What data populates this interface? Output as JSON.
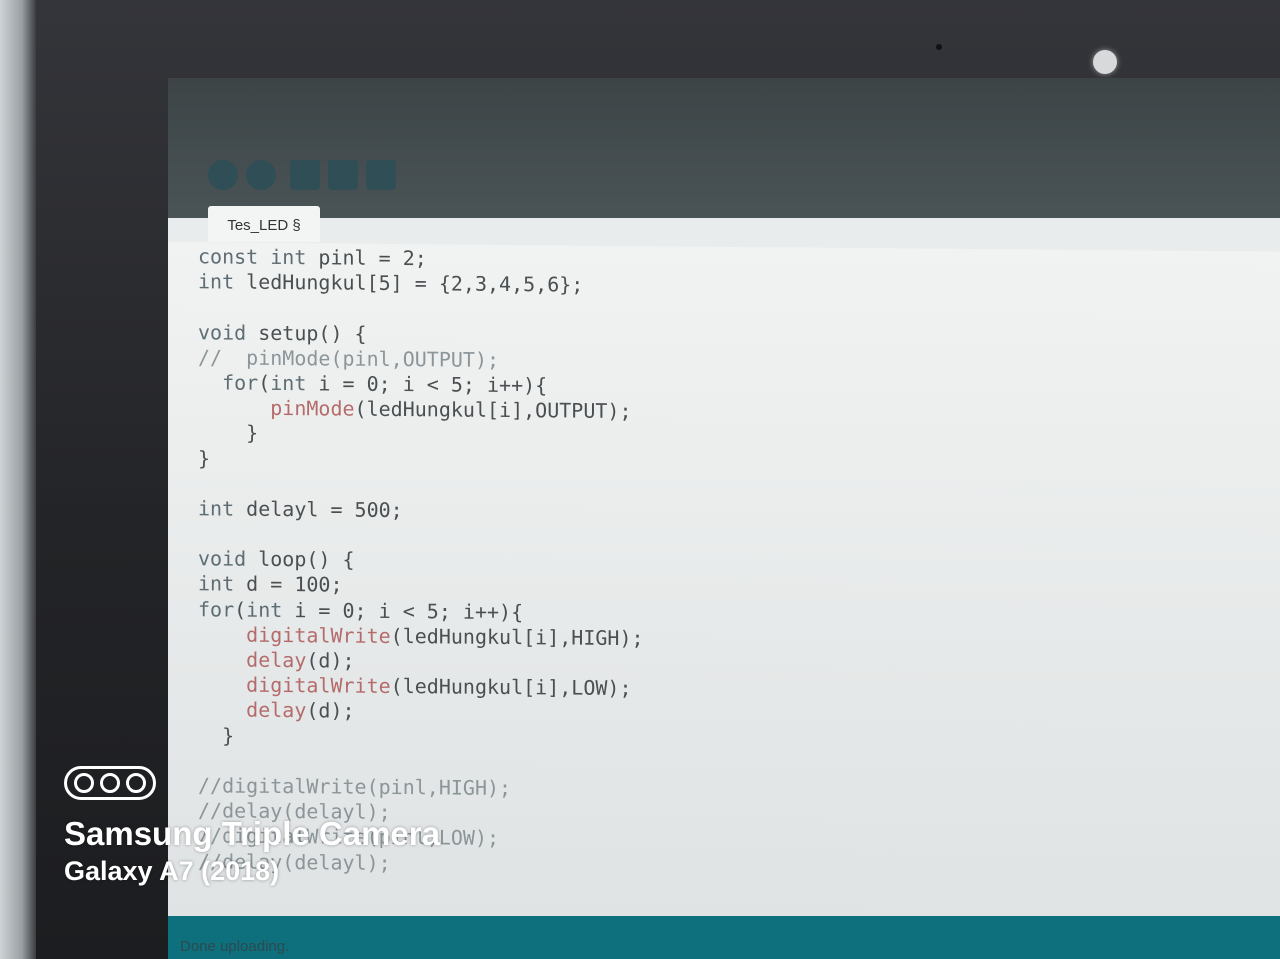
{
  "window": {
    "menu_items": [
      "⊞",
      "⊟",
      "⊠",
      "⊡",
      "⊞",
      "⊟",
      "⊠",
      "⊡"
    ],
    "tab_label": "Tes_LED §"
  },
  "editor": {
    "lines": [
      {
        "text": "const int pinl = 2;",
        "indent": 0
      },
      {
        "text": "int ledHungkul[5] = {2,3,4,5,6};",
        "indent": 0
      },
      {
        "text": "",
        "indent": 0
      },
      {
        "text": "void setup() {",
        "indent": 0
      },
      {
        "text": "//  pinMode(pinl,OUTPUT);",
        "indent": 0
      },
      {
        "text": "  for(int i = 0; i < 5; i++){",
        "indent": 0
      },
      {
        "text": "      pinMode(ledHungkul[i],OUTPUT);",
        "indent": 0
      },
      {
        "text": "    }",
        "indent": 0
      },
      {
        "text": "}",
        "indent": 0
      },
      {
        "text": "",
        "indent": 0
      },
      {
        "text": "int delayl = 500;",
        "indent": 0
      },
      {
        "text": "",
        "indent": 0
      },
      {
        "text": "void loop() {",
        "indent": 0
      },
      {
        "text": "int d = 100;",
        "indent": 0
      },
      {
        "text": "for(int i = 0; i < 5; i++){",
        "indent": 0
      },
      {
        "text": "    digitalWrite(ledHungkul[i],HIGH);",
        "indent": 0
      },
      {
        "text": "    delay(d);",
        "indent": 0
      },
      {
        "text": "    digitalWrite(ledHungkul[i],LOW);",
        "indent": 0
      },
      {
        "text": "    delay(d);",
        "indent": 0
      },
      {
        "text": "  }",
        "indent": 0
      },
      {
        "text": "",
        "indent": 0
      },
      {
        "text": "//digitalWrite(pinl,HIGH);",
        "indent": 0
      },
      {
        "text": "//delay(delayl);",
        "indent": 0
      },
      {
        "text": "//digitalWrite(pinl,LOW);",
        "indent": 0
      },
      {
        "text": "//delay(delayl);",
        "indent": 0
      }
    ]
  },
  "status": {
    "message": "Done uploading."
  },
  "watermark": {
    "title": "Samsung Triple Camera",
    "subtitle": "Galaxy A7 (2018)"
  },
  "colors": {
    "status_bar": "#0e6f7d",
    "editor_bg": "#f1f3f2",
    "function_color": "#b56b6b"
  }
}
